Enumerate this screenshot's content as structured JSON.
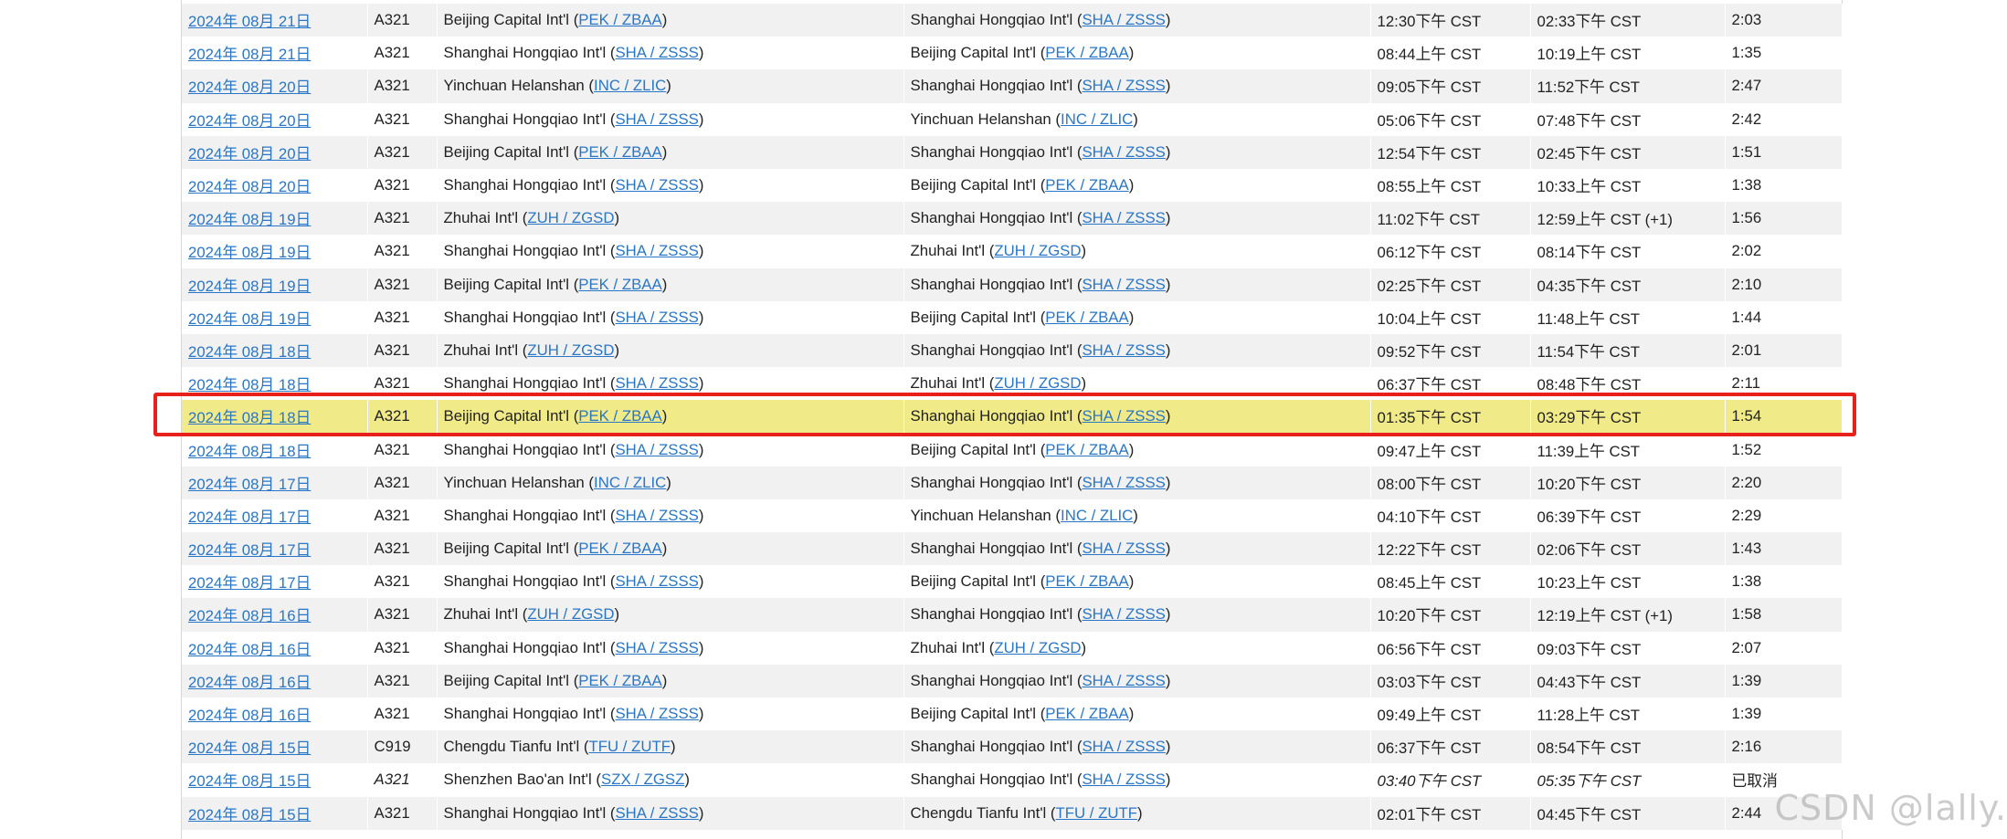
{
  "watermark": "CSDN @lally.",
  "colors": {
    "link": "#2a76c6",
    "row_alt": "#f1f1f1",
    "highlight_row": "#f0ea88",
    "annotation_box": "#e8201c"
  },
  "flights": [
    {
      "date": "2024年 08月 21日",
      "aircraft": "A321",
      "origin": {
        "name": "Beijing Capital Int'l",
        "code": "PEK / ZBAA"
      },
      "destination": {
        "name": "Shanghai Hongqiao Int'l",
        "code": "SHA / ZSSS"
      },
      "departure": "12:30下午 CST",
      "arrival": "02:33下午 CST",
      "duration": "2:03"
    },
    {
      "date": "2024年 08月 21日",
      "aircraft": "A321",
      "origin": {
        "name": "Shanghai Hongqiao Int'l",
        "code": "SHA / ZSSS"
      },
      "destination": {
        "name": "Beijing Capital Int'l",
        "code": "PEK / ZBAA"
      },
      "departure": "08:44上午 CST",
      "arrival": "10:19上午 CST",
      "duration": "1:35"
    },
    {
      "date": "2024年 08月 20日",
      "aircraft": "A321",
      "origin": {
        "name": "Yinchuan Helanshan",
        "code": "INC / ZLIC"
      },
      "destination": {
        "name": "Shanghai Hongqiao Int'l",
        "code": "SHA / ZSSS"
      },
      "departure": "09:05下午 CST",
      "arrival": "11:52下午 CST",
      "duration": "2:47"
    },
    {
      "date": "2024年 08月 20日",
      "aircraft": "A321",
      "origin": {
        "name": "Shanghai Hongqiao Int'l",
        "code": "SHA / ZSSS"
      },
      "destination": {
        "name": "Yinchuan Helanshan",
        "code": "INC / ZLIC"
      },
      "departure": "05:06下午 CST",
      "arrival": "07:48下午 CST",
      "duration": "2:42"
    },
    {
      "date": "2024年 08月 20日",
      "aircraft": "A321",
      "origin": {
        "name": "Beijing Capital Int'l",
        "code": "PEK / ZBAA"
      },
      "destination": {
        "name": "Shanghai Hongqiao Int'l",
        "code": "SHA / ZSSS"
      },
      "departure": "12:54下午 CST",
      "arrival": "02:45下午 CST",
      "duration": "1:51"
    },
    {
      "date": "2024年 08月 20日",
      "aircraft": "A321",
      "origin": {
        "name": "Shanghai Hongqiao Int'l",
        "code": "SHA / ZSSS"
      },
      "destination": {
        "name": "Beijing Capital Int'l",
        "code": "PEK / ZBAA"
      },
      "departure": "08:55上午 CST",
      "arrival": "10:33上午 CST",
      "duration": "1:38"
    },
    {
      "date": "2024年 08月 19日",
      "aircraft": "A321",
      "origin": {
        "name": "Zhuhai Int'l",
        "code": "ZUH / ZGSD"
      },
      "destination": {
        "name": "Shanghai Hongqiao Int'l",
        "code": "SHA / ZSSS"
      },
      "departure": "11:02下午 CST",
      "arrival": "12:59上午 CST (+1)",
      "duration": "1:56"
    },
    {
      "date": "2024年 08月 19日",
      "aircraft": "A321",
      "origin": {
        "name": "Shanghai Hongqiao Int'l",
        "code": "SHA / ZSSS"
      },
      "destination": {
        "name": "Zhuhai Int'l",
        "code": "ZUH / ZGSD"
      },
      "departure": "06:12下午 CST",
      "arrival": "08:14下午 CST",
      "duration": "2:02"
    },
    {
      "date": "2024年 08月 19日",
      "aircraft": "A321",
      "origin": {
        "name": "Beijing Capital Int'l",
        "code": "PEK / ZBAA"
      },
      "destination": {
        "name": "Shanghai Hongqiao Int'l",
        "code": "SHA / ZSSS"
      },
      "departure": "02:25下午 CST",
      "arrival": "04:35下午 CST",
      "duration": "2:10"
    },
    {
      "date": "2024年 08月 19日",
      "aircraft": "A321",
      "origin": {
        "name": "Shanghai Hongqiao Int'l",
        "code": "SHA / ZSSS"
      },
      "destination": {
        "name": "Beijing Capital Int'l",
        "code": "PEK / ZBAA"
      },
      "departure": "10:04上午 CST",
      "arrival": "11:48上午 CST",
      "duration": "1:44"
    },
    {
      "date": "2024年 08月 18日",
      "aircraft": "A321",
      "origin": {
        "name": "Zhuhai Int'l",
        "code": "ZUH / ZGSD"
      },
      "destination": {
        "name": "Shanghai Hongqiao Int'l",
        "code": "SHA / ZSSS"
      },
      "departure": "09:52下午 CST",
      "arrival": "11:54下午 CST",
      "duration": "2:01"
    },
    {
      "date": "2024年 08月 18日",
      "aircraft": "A321",
      "origin": {
        "name": "Shanghai Hongqiao Int'l",
        "code": "SHA / ZSSS"
      },
      "destination": {
        "name": "Zhuhai Int'l",
        "code": "ZUH / ZGSD"
      },
      "departure": "06:37下午 CST",
      "arrival": "08:48下午 CST",
      "duration": "2:11"
    },
    {
      "date": "2024年 08月 18日",
      "aircraft": "A321",
      "origin": {
        "name": "Beijing Capital Int'l",
        "code": "PEK / ZBAA"
      },
      "destination": {
        "name": "Shanghai Hongqiao Int'l",
        "code": "SHA / ZSSS"
      },
      "departure": "01:35下午 CST",
      "arrival": "03:29下午 CST",
      "duration": "1:54",
      "highlighted": true
    },
    {
      "date": "2024年 08月 18日",
      "aircraft": "A321",
      "origin": {
        "name": "Shanghai Hongqiao Int'l",
        "code": "SHA / ZSSS"
      },
      "destination": {
        "name": "Beijing Capital Int'l",
        "code": "PEK / ZBAA"
      },
      "departure": "09:47上午 CST",
      "arrival": "11:39上午 CST",
      "duration": "1:52"
    },
    {
      "date": "2024年 08月 17日",
      "aircraft": "A321",
      "origin": {
        "name": "Yinchuan Helanshan",
        "code": "INC / ZLIC"
      },
      "destination": {
        "name": "Shanghai Hongqiao Int'l",
        "code": "SHA / ZSSS"
      },
      "departure": "08:00下午 CST",
      "arrival": "10:20下午 CST",
      "duration": "2:20"
    },
    {
      "date": "2024年 08月 17日",
      "aircraft": "A321",
      "origin": {
        "name": "Shanghai Hongqiao Int'l",
        "code": "SHA / ZSSS"
      },
      "destination": {
        "name": "Yinchuan Helanshan",
        "code": "INC / ZLIC"
      },
      "departure": "04:10下午 CST",
      "arrival": "06:39下午 CST",
      "duration": "2:29"
    },
    {
      "date": "2024年 08月 17日",
      "aircraft": "A321",
      "origin": {
        "name": "Beijing Capital Int'l",
        "code": "PEK / ZBAA"
      },
      "destination": {
        "name": "Shanghai Hongqiao Int'l",
        "code": "SHA / ZSSS"
      },
      "departure": "12:22下午 CST",
      "arrival": "02:06下午 CST",
      "duration": "1:43"
    },
    {
      "date": "2024年 08月 17日",
      "aircraft": "A321",
      "origin": {
        "name": "Shanghai Hongqiao Int'l",
        "code": "SHA / ZSSS"
      },
      "destination": {
        "name": "Beijing Capital Int'l",
        "code": "PEK / ZBAA"
      },
      "departure": "08:45上午 CST",
      "arrival": "10:23上午 CST",
      "duration": "1:38"
    },
    {
      "date": "2024年 08月 16日",
      "aircraft": "A321",
      "origin": {
        "name": "Zhuhai Int'l",
        "code": "ZUH / ZGSD"
      },
      "destination": {
        "name": "Shanghai Hongqiao Int'l",
        "code": "SHA / ZSSS"
      },
      "departure": "10:20下午 CST",
      "arrival": "12:19上午 CST (+1)",
      "duration": "1:58"
    },
    {
      "date": "2024年 08月 16日",
      "aircraft": "A321",
      "origin": {
        "name": "Shanghai Hongqiao Int'l",
        "code": "SHA / ZSSS"
      },
      "destination": {
        "name": "Zhuhai Int'l",
        "code": "ZUH / ZGSD"
      },
      "departure": "06:56下午 CST",
      "arrival": "09:03下午 CST",
      "duration": "2:07"
    },
    {
      "date": "2024年 08月 16日",
      "aircraft": "A321",
      "origin": {
        "name": "Beijing Capital Int'l",
        "code": "PEK / ZBAA"
      },
      "destination": {
        "name": "Shanghai Hongqiao Int'l",
        "code": "SHA / ZSSS"
      },
      "departure": "03:03下午 CST",
      "arrival": "04:43下午 CST",
      "duration": "1:39"
    },
    {
      "date": "2024年 08月 16日",
      "aircraft": "A321",
      "origin": {
        "name": "Shanghai Hongqiao Int'l",
        "code": "SHA / ZSSS"
      },
      "destination": {
        "name": "Beijing Capital Int'l",
        "code": "PEK / ZBAA"
      },
      "departure": "09:49上午 CST",
      "arrival": "11:28上午 CST",
      "duration": "1:39"
    },
    {
      "date": "2024年 08月 15日",
      "aircraft": "C919",
      "origin": {
        "name": "Chengdu Tianfu Int'l",
        "code": "TFU / ZUTF"
      },
      "destination": {
        "name": "Shanghai Hongqiao Int'l",
        "code": "SHA / ZSSS"
      },
      "departure": "06:37下午 CST",
      "arrival": "08:54下午 CST",
      "duration": "2:16"
    },
    {
      "date": "2024年 08月 15日",
      "aircraft": "A321",
      "origin": {
        "name": "Shenzhen Bao'an Int'l",
        "code": "SZX / ZGSZ"
      },
      "destination": {
        "name": "Shanghai Hongqiao Int'l",
        "code": "SHA / ZSSS"
      },
      "departure": "03:40下午 CST",
      "arrival": "05:35下午 CST",
      "duration": "已取消",
      "cancelled": true
    },
    {
      "date": "2024年 08月 15日",
      "aircraft": "A321",
      "origin": {
        "name": "Shanghai Hongqiao Int'l",
        "code": "SHA / ZSSS"
      },
      "destination": {
        "name": "Chengdu Tianfu Int'l",
        "code": "TFU / ZUTF"
      },
      "departure": "02:01下午 CST",
      "arrival": "04:45下午 CST",
      "duration": "2:44"
    }
  ]
}
